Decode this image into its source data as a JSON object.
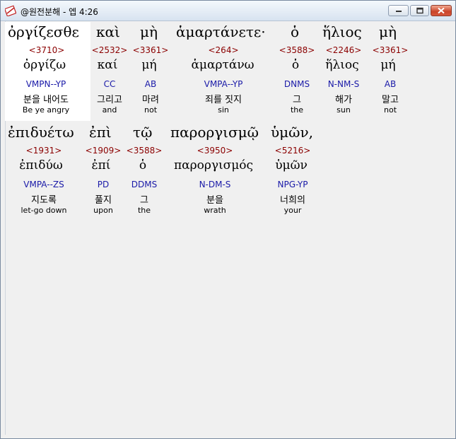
{
  "window": {
    "title": "@원전분해 - 엡 4:26",
    "icons": [
      "app-icon",
      "minimize-icon",
      "maximize-icon",
      "close-icon"
    ]
  },
  "colors": {
    "strong_number": "#8b0000",
    "morphology": "#1a1aa8",
    "highlight": "#ffffff"
  },
  "words": [
    {
      "greek": "ὀργίζεσθε",
      "number": "<3710>",
      "lemma": "ὀργίζω",
      "morph": "VMPN--YP",
      "korean": "분을 내어도",
      "english": "Be ye angry"
    },
    {
      "greek": "καὶ",
      "number": "<2532>",
      "lemma": "καί",
      "morph": "CC",
      "korean": "그리고",
      "english": "and"
    },
    {
      "greek": "μὴ",
      "number": "<3361>",
      "lemma": "μή",
      "morph": "AB",
      "korean": "마려",
      "english": "not"
    },
    {
      "greek": "ἁμαρτάνετε·",
      "number": "<264>",
      "lemma": "ἁμαρτάνω",
      "morph": "VMPA--YP",
      "korean": "죄를 짓지",
      "english": "sin"
    },
    {
      "greek": "ὁ",
      "number": "<3588>",
      "lemma": "ὁ",
      "morph": "DNMS",
      "korean": "그",
      "english": "the"
    },
    {
      "greek": "ἥλιος",
      "number": "<2246>",
      "lemma": "ἥλιος",
      "morph": "N-NM-S",
      "korean": "해가",
      "english": "sun"
    },
    {
      "greek": "μὴ",
      "number": "<3361>",
      "lemma": "μή",
      "morph": "AB",
      "korean": "말고",
      "english": "not"
    },
    {
      "greek": "ἐπιδυέτω",
      "number": "<1931>",
      "lemma": "ἐπιδύω",
      "morph": "VMPA--ZS",
      "korean": "지도록",
      "english": "let-go down"
    },
    {
      "greek": "ἐπὶ",
      "number": "<1909>",
      "lemma": "ἐπί",
      "morph": "PD",
      "korean": "풀지",
      "english": "upon"
    },
    {
      "greek": "τῷ",
      "number": "<3588>",
      "lemma": "ὁ",
      "morph": "DDMS",
      "korean": "그",
      "english": "the"
    },
    {
      "greek": "παροργισμῷ",
      "number": "<3950>",
      "lemma": "παροργισμός",
      "morph": "N-DM-S",
      "korean": "분을",
      "english": "wrath"
    },
    {
      "greek": "ὑμῶν,",
      "number": "<5216>",
      "lemma": "ὑμῶν",
      "morph": "NPG-YP",
      "korean": "너희의",
      "english": "your"
    }
  ]
}
